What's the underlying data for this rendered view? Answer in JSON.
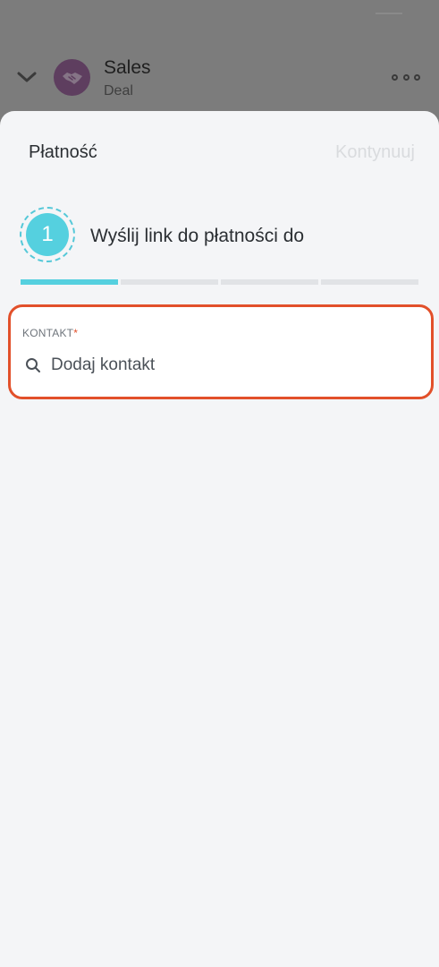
{
  "background": {
    "title": "Sales",
    "subtitle": "Deal",
    "avatar_icon": "handshake-icon",
    "more_icon": "more-dots-icon",
    "chevron_icon": "chevron-down-icon"
  },
  "sheet": {
    "title": "Płatność",
    "continue_label": "Kontynuuj",
    "step": {
      "number": "1",
      "label": "Wyślij link do płatności do"
    },
    "progress": {
      "total_steps": 4,
      "current_step": 1
    },
    "contact": {
      "label": "KONTAKT",
      "required_mark": "*",
      "placeholder": "Dodaj kontakt",
      "search_icon": "search-icon"
    }
  },
  "colors": {
    "accent": "#55d0df",
    "highlight_border": "#e2502a",
    "sheet_bg": "#f4f5f7",
    "overlay": "#7c7c7c"
  }
}
